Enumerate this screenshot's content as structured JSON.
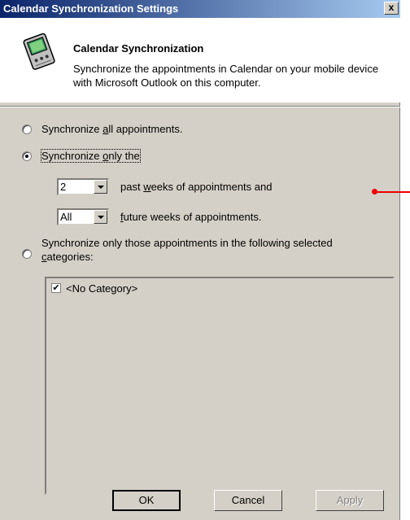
{
  "window": {
    "title": "Calendar Synchronization Settings",
    "close_glyph": "x"
  },
  "header": {
    "title": "Calendar Synchronization",
    "description": "Synchronize the appointments in Calendar on your mobile device with Microsoft Outlook on this computer.",
    "icon": "handheld-device-icon"
  },
  "options": {
    "all_appointments": {
      "pre": "Synchronize ",
      "accel": "a",
      "post": "ll appointments.",
      "checked": false
    },
    "only_the": {
      "pre": "Synchronize ",
      "accel": "o",
      "post": "nly the",
      "checked": true
    },
    "past_weeks": {
      "value": "2",
      "pre": "past ",
      "accel": "w",
      "post": "eeks of appointments and"
    },
    "future_weeks": {
      "value": "All",
      "pre": "",
      "accel": "f",
      "post": "uture weeks of appointments."
    },
    "categories": {
      "line1": "Synchronize only those appointments in the following selected",
      "accel": "c",
      "line2_post": "ategories:",
      "checked": false
    }
  },
  "category_list": [
    {
      "label": "<No Category>",
      "checked": true
    }
  ],
  "buttons": {
    "ok": "OK",
    "cancel": "Cancel",
    "apply": "Apply"
  }
}
